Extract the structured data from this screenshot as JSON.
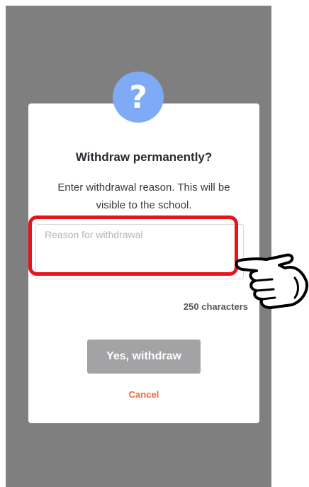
{
  "dialog": {
    "icon": "question-mark-icon",
    "icon_glyph": "?",
    "icon_color": "#7faaf5",
    "title": "Withdraw permanently?",
    "message": "Enter withdrawal reason. This will be visible to the school.",
    "reason_input": {
      "placeholder": "Reason for withdrawal",
      "value": ""
    },
    "char_counter": "250 characters",
    "confirm_label": "Yes, withdraw",
    "cancel_label": "Cancel"
  },
  "annotation": {
    "highlight_color": "#e8141c",
    "pointer_icon": "pointing-hand-icon"
  },
  "colors": {
    "overlay": "#7f7f7f",
    "confirm_disabled": "#a3a3a6",
    "cancel": "#ee6a2f"
  }
}
